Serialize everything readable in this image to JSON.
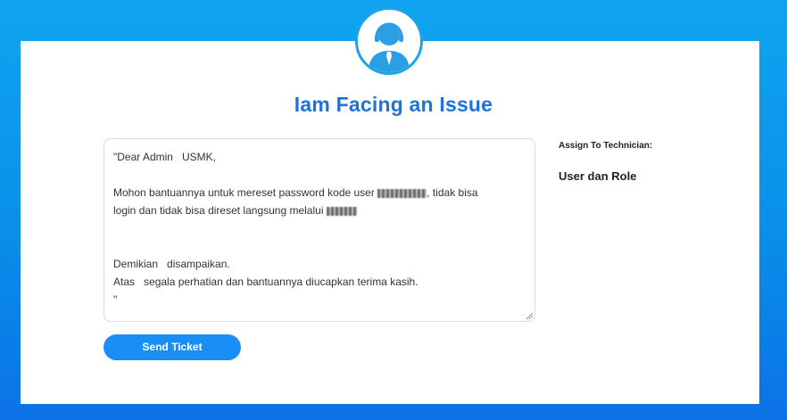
{
  "header": {
    "title": "Iam Facing an Issue"
  },
  "ticket": {
    "greeting": "\"Dear Admin   USMK,",
    "line1_start": "Mohon bantuannya untuk mereset password kode user",
    "line1_end": ", tidak bisa",
    "line2_start": "login dan tidak bisa direset langsung melalui",
    "closing1": "Demikian   disampaikan.",
    "closing2": "Atas   segala perhatian dan bantuannya diucapkan terima kasih.",
    "end_quote": "\""
  },
  "actions": {
    "send_label": "Send Ticket"
  },
  "assign": {
    "label": "Assign To Technician:",
    "value": "User dan Role"
  },
  "icons": {
    "avatar": "user-avatar-icon",
    "resize": "resize-handle-icon"
  },
  "colors": {
    "accent": "#1e73d8",
    "button": "#1a8ef5",
    "background": "#0a8fe9"
  }
}
